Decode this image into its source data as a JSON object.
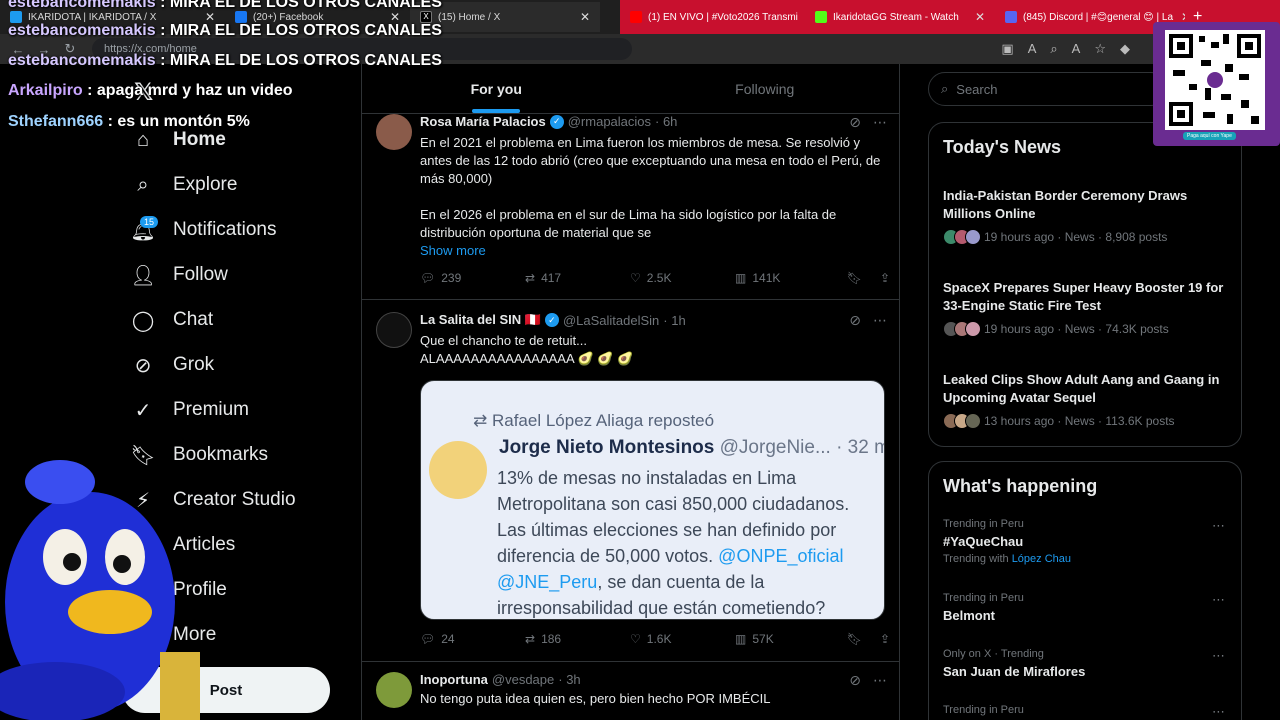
{
  "browser": {
    "tabs": [
      {
        "label": "IKARIDOTA | IKARIDOTA / X",
        "color": "#1d9bf0"
      },
      {
        "label": "(20+) Facebook",
        "color": "#1877f2"
      },
      {
        "label": "(15) Home / X",
        "color": "#000000"
      }
    ],
    "red_tabs": [
      {
        "label": "(1) EN VIVO | #Voto2026 Transmi",
        "color": "#ff0000"
      },
      {
        "label": "IkaridotaGG Stream - Watch",
        "color": "#53fc18"
      },
      {
        "label": "(845) Discord | #😊general 😊 | La",
        "color": "#5865f2"
      }
    ],
    "url": "https://x.com/home"
  },
  "chat": [
    {
      "user": "estebancomemakis",
      "message": " : MIRA EL DE LOS OTROS CANALES"
    },
    {
      "user": "estebancomemakis",
      "message": " : MIRA EL DE LOS OTROS CANALES"
    },
    {
      "user": "estebancomemakis",
      "message": " : MIRA EL DE LOS OTROS CANALES"
    },
    {
      "user": "Arkailpiro",
      "message": " : apaga mrd y haz un video"
    },
    {
      "user": "Sthefann666",
      "message": " : es un montón 5%"
    }
  ],
  "nav": {
    "items": [
      "Home",
      "Explore",
      "Notifications",
      "Follow",
      "Chat",
      "Grok",
      "Premium",
      "Bookmarks",
      "Creator Studio",
      "Articles",
      "Profile",
      "More"
    ],
    "notif_badge": "15",
    "post_label": "Post"
  },
  "timeline": {
    "tab_for_you": "For you",
    "tab_following": "Following",
    "tweets": [
      {
        "name": "Rosa María Palacios",
        "handle": "@rmapalacios",
        "time": "· 6h",
        "text1": "En el 2021 el problema en Lima fueron los miembros de mesa. Se resolvió y antes de las 12 todo abrió (creo que exceptuando una mesa en todo el Perú, de más 80,000)",
        "text2": "En el 2026 el problema en el sur de Lima ha sido logístico por la falta de distribución oportuna de material que se",
        "show_more": "Show more",
        "replies": "239",
        "reposts": "417",
        "likes": "2.5K",
        "views": "141K"
      },
      {
        "name": "La Salita del SIN 🇵🇪",
        "handle": "@LaSalitadelSin",
        "time": "· 1h",
        "text1": "Que el chancho te de retuit...",
        "text2": "ALAAAAAAAAAAAAAAAA 🥑 🥑 🥑",
        "quote": {
          "repost_line": "Rafael López Aliaga reposteó",
          "name": "Jorge Nieto Montesinos",
          "handle": "@JorgeNie... · 32 m",
          "lines": [
            "13% de mesas no instaladas en Lima",
            "Metropolitana son casi 850,000 ciudadanos.",
            "Las últimas elecciones se han definido por",
            "diferencia de 50,000 votos.",
            "@ONPE_oficial",
            "@JNE_Peru",
            ", se dan cuenta de la",
            "irresponsabilidad que están cometiendo?"
          ]
        },
        "replies": "24",
        "reposts": "186",
        "likes": "1.6K",
        "views": "57K"
      },
      {
        "name": "Inoportuna",
        "handle": "@vesdape",
        "time": "· 3h",
        "text1": "No tengo puta idea quien es, pero bien hecho POR IMBÉCIL"
      }
    ]
  },
  "right": {
    "search_placeholder": "Search",
    "news_title": "Today's News",
    "news": [
      {
        "title": "India-Pakistan Border Ceremony Draws Millions Online",
        "meta": "19 hours ago · News · 8,908 posts"
      },
      {
        "title": "SpaceX Prepares Super Heavy Booster 19 for 33-Engine Static Fire Test",
        "meta": "19 hours ago · News · 74.3K posts"
      },
      {
        "title": "Leaked Clips Show Adult Aang and Gaang in Upcoming Avatar Sequel",
        "meta": "13 hours ago · News · 113.6K posts"
      }
    ],
    "happening_title": "What's happening",
    "trends": [
      {
        "context": "Trending in Peru",
        "title": "#YaQueChau",
        "with": "Trending with",
        "with_link": "López Chau"
      },
      {
        "context": "Trending in Peru",
        "title": "Belmont"
      },
      {
        "context": "Only on X · Trending",
        "title": "San Juan de Miraflores"
      },
      {
        "context": "Trending in Peru",
        "title": ""
      }
    ]
  },
  "qr": {
    "caption": "Paga aquí con Yape"
  }
}
